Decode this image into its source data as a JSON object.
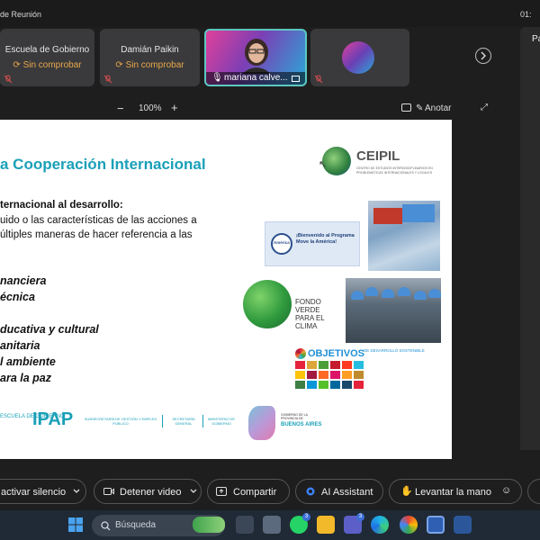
{
  "window": {
    "title": "de Reunión",
    "clock": "01:"
  },
  "participants": [
    {
      "name": "Escuela de Gobierno",
      "status": "Sin comprobar"
    },
    {
      "name": "Damián Paikin",
      "status": "Sin comprobar"
    },
    {
      "name": "mariana calve..."
    }
  ],
  "side_panel": {
    "label": "Pa"
  },
  "zoom": {
    "value": "100%",
    "minus": "−",
    "plus": "+"
  },
  "annotate": {
    "label": "Anotar"
  },
  "slide": {
    "title": "a Cooperación Internacional",
    "subtitle": "ternacional al desarrollo:",
    "body": [
      "uido  o  las  características  de  las  acciones  a",
      "últiples maneras de hacer referencia a las"
    ],
    "items": [
      "nanciera",
      "écnica",
      "ducativa  y cultural",
      "anitaria",
      "l ambiente",
      "ara la paz"
    ],
    "ceipil": {
      "name": "CEIPIL",
      "sub": "CENTRO DE ESTUDIOS INTERDISCIPLINARIOS EN PROBLEMÁTICAS INTERNACIONALES Y LOCALES"
    },
    "america": {
      "logo": "América",
      "text": "¡Bienvenido al Programa Move la América!"
    },
    "fondo": "FONDO VERDE PARA EL CLIMA",
    "ods": {
      "title": "OBJETIVOS",
      "sub": "DE DESARROLLO SOSTENIBLE"
    },
    "footer": {
      "escuela": "ESCUELA DE GOBIERNO",
      "ipap": "IPAP",
      "subsecretaria": "SUBSECRETARÍA DE GESTIÓN Y EMPLEO PÚBLICO",
      "secretaria": "SECRETARÍA GENERAL",
      "ministerio": "MINISTERIO DE GOBIERNO",
      "ba_small": "GOBIERNO DE LA PROVINCIA DE",
      "ba_name": "BUENOS AIRES"
    }
  },
  "toolbar": {
    "unmute": "activar silencio",
    "stop_video": "Detener video",
    "share": "Compartir",
    "ai": "AI Assistant",
    "raise_hand": "Levantar la mano"
  },
  "taskbar": {
    "search": "Búsqueda",
    "whatsapp_badge": "3",
    "teams_badge": "3"
  },
  "colors": {
    "accent": "#1aa0b8",
    "warning": "#e8a84a",
    "tile": "#3a3a3c"
  }
}
